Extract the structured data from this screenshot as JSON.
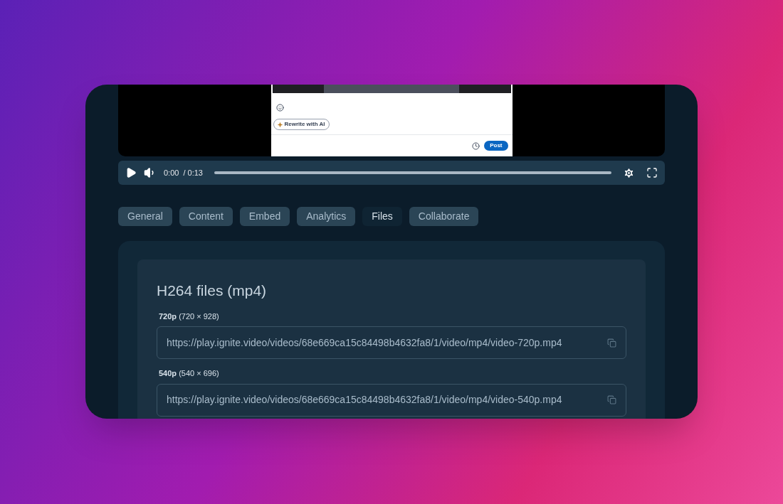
{
  "video_preview": {
    "ai_button": "Rewrite with AI",
    "post_button": "Post"
  },
  "player": {
    "current_time": "0:00",
    "duration": "/ 0:13",
    "progress": {
      "level": 0
    }
  },
  "tabs": [
    {
      "label": "General",
      "selected": false
    },
    {
      "label": "Content",
      "selected": false
    },
    {
      "label": "Embed",
      "selected": false
    },
    {
      "label": "Analytics",
      "selected": false
    },
    {
      "label": "Files",
      "selected": true
    },
    {
      "label": "Collaborate",
      "selected": false
    }
  ],
  "files_section": {
    "title": "H264 files (mp4)",
    "files": [
      {
        "label": "**720p** (720 × 928)",
        "url": "https://play.ignite.video/videos/68e669ca15c84498b4632fa8/1/video/mp4/video-720p.mp4"
      },
      {
        "label": "**540p** (540 × 696)",
        "url": "https://play.ignite.video/videos/68e669ca15c84498b4632fa8/1/video/mp4/video-540p.mp4"
      }
    ]
  }
}
